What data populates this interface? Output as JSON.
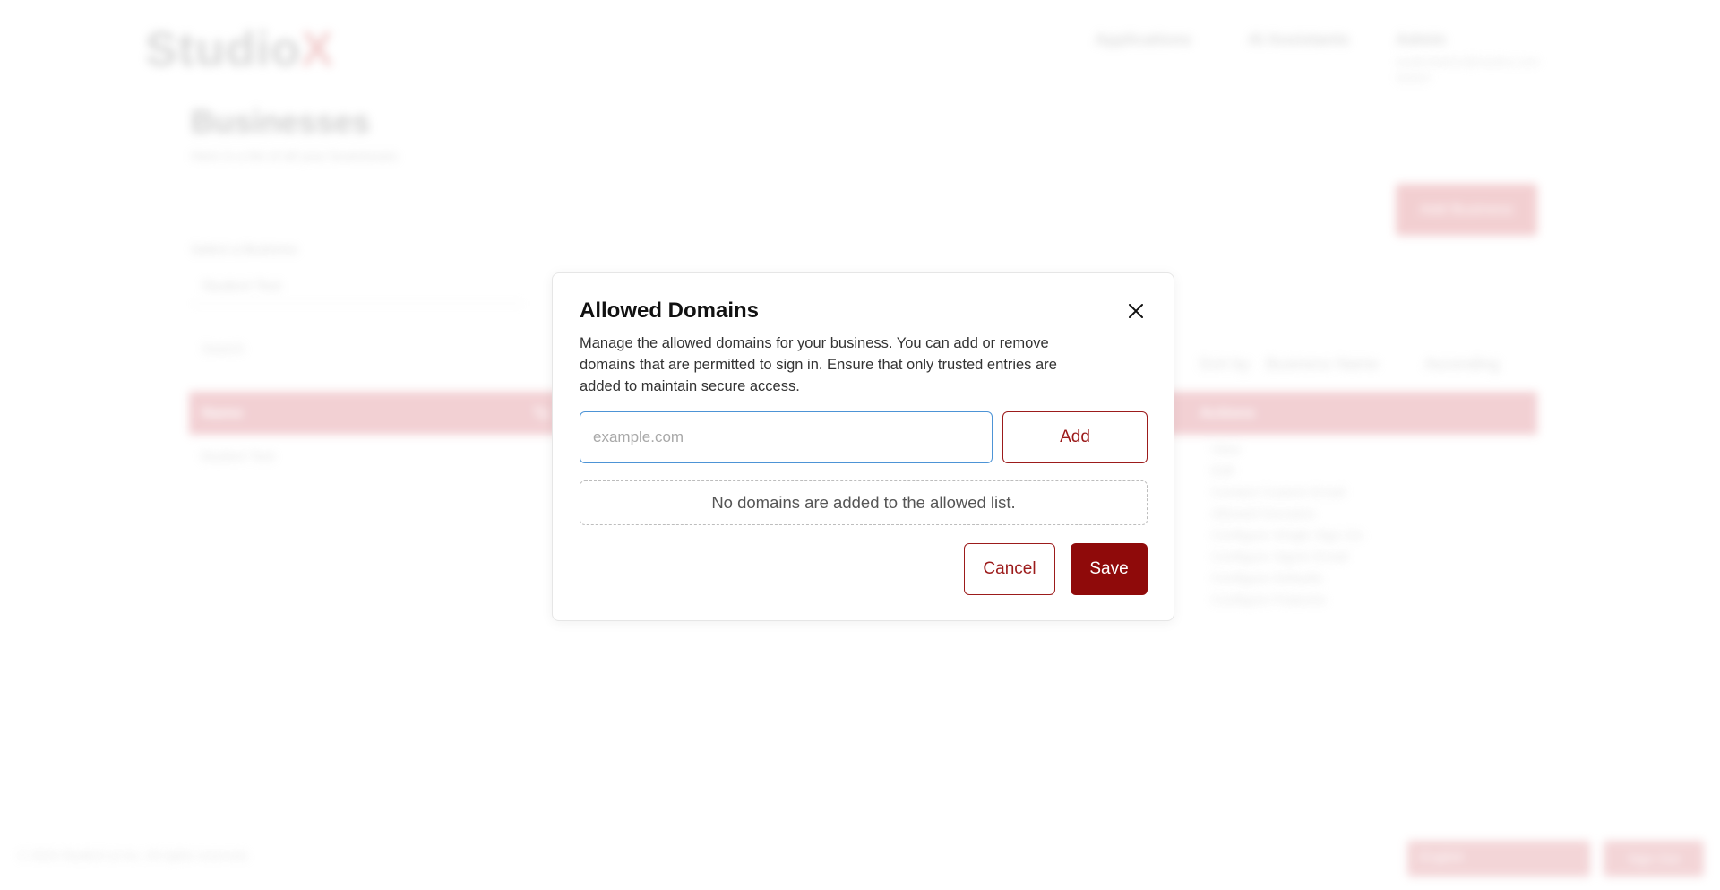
{
  "background": {
    "logo": {
      "text": "Studio",
      "accent": "X"
    },
    "nav": {
      "applications": "Applications",
      "ai_assistants": "AI Assistants",
      "admin": "Admin",
      "admin_sub": "studentadmin@studiox.com Switch"
    },
    "page": {
      "title": "Businesses",
      "subtitle": "Here is a list of all your businesses",
      "add_business_label": "Add Business",
      "select_label": "Select a Business",
      "select_value": "Student Test",
      "search_placeholder": "Search",
      "sort_by_label": "Sort by",
      "sort_field": "Business Name",
      "sort_order": "Ascending"
    },
    "table": {
      "columns": [
        "Name",
        "Ty",
        "Actions"
      ],
      "row_name": "Student Test",
      "actions": [
        "View",
        "Edit",
        "Contact Custom Email",
        "Allowed Domains",
        "Configure Single Sign On",
        "Configure Signin Email",
        "Configure Defaults",
        "Configure Features"
      ]
    },
    "footer": {
      "copyright": "© 2024 StudioX.ai Inc. All rights reserved.",
      "language": "English",
      "signout": "Sign Out"
    }
  },
  "modal": {
    "title": "Allowed Domains",
    "description": "Manage the allowed domains for your business. You can add or remove domains that are permitted to sign in. Ensure that only trusted entries are added to maintain secure access.",
    "input": {
      "value": "",
      "placeholder": "example.com"
    },
    "add_label": "Add",
    "empty_message": "No domains are added to the allowed list.",
    "cancel_label": "Cancel",
    "save_label": "Save",
    "close_icon": "close-icon"
  },
  "colors": {
    "primary": "#8f0a0a",
    "primary_outline": "#9c1b1b",
    "input_focus": "#4d94d6",
    "table_header_bg": "#e8aab0"
  }
}
